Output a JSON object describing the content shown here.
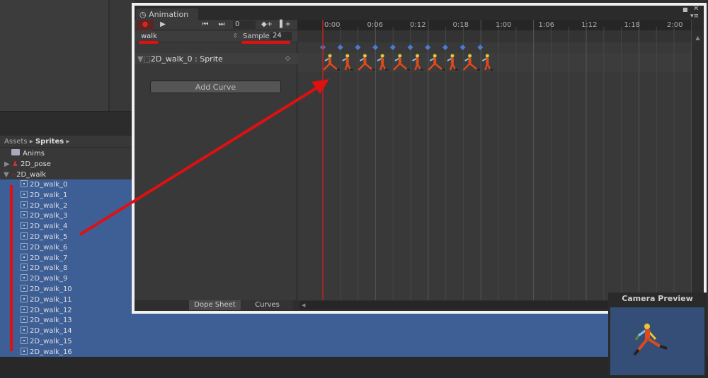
{
  "window": {
    "tab_title": "Animation"
  },
  "toolbar": {
    "frame_value": "0"
  },
  "clip": {
    "name": "walk",
    "sample_label": "Sample",
    "sample_value": "24"
  },
  "property": {
    "label": "2D_walk_0 : Sprite"
  },
  "add_curve_label": "Add Curve",
  "ruler_labels": [
    "0:00",
    "0:06",
    "0:12",
    "0:18",
    "1:00",
    "1:06",
    "1:12",
    "1:18",
    "2:00"
  ],
  "keyframe_count": 10,
  "bottom_tabs": {
    "dope_sheet": "Dope Sheet",
    "curves": "Curves"
  },
  "project": {
    "breadcrumb": [
      "Assets",
      "Sprites"
    ],
    "items": [
      {
        "label": "Anims",
        "type": "folder"
      },
      {
        "label": "2D_pose",
        "type": "sprite"
      },
      {
        "label": "2D_walk",
        "type": "sprite"
      }
    ],
    "sprites": [
      "2D_walk_0",
      "2D_walk_1",
      "2D_walk_2",
      "2D_walk_3",
      "2D_walk_4",
      "2D_walk_5",
      "2D_walk_6",
      "2D_walk_7",
      "2D_walk_8",
      "2D_walk_9",
      "2D_walk_10",
      "2D_walk_11",
      "2D_walk_12",
      "2D_walk_13",
      "2D_walk_14",
      "2D_walk_15",
      "2D_walk_16"
    ]
  },
  "camera_preview": {
    "title": "Camera Preview"
  },
  "colors": {
    "selection": "#3d5f96",
    "annotation": "#e01010",
    "keyframe": "#4a7bd0",
    "playhead": "#c02020"
  }
}
